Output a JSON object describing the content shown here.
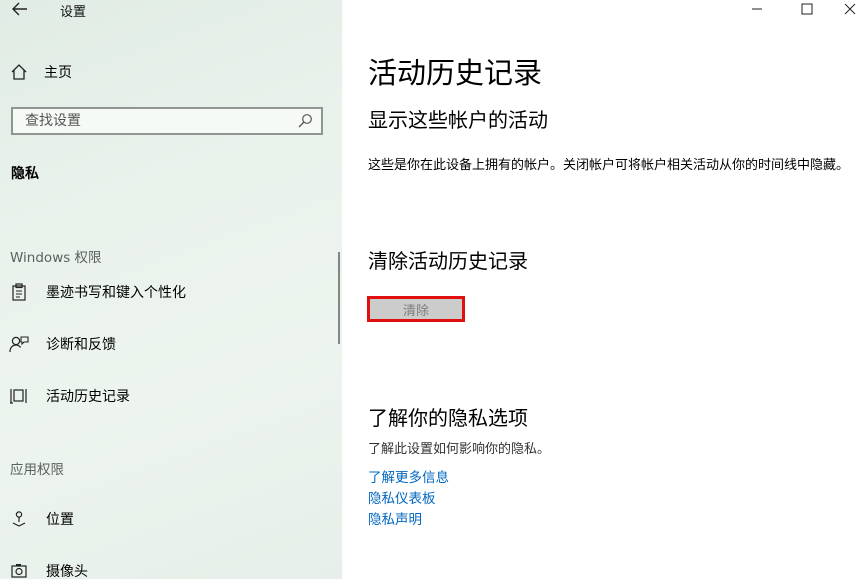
{
  "window": {
    "title": "设置",
    "controls": {
      "minimize": "—",
      "maximize": "☐",
      "close": "✕"
    }
  },
  "sidebar": {
    "home_label": "主页",
    "search": {
      "placeholder": "查找设置",
      "value": ""
    },
    "category": "隐私",
    "sections": [
      {
        "title": "Windows 权限",
        "items": [
          {
            "label": "墨迹书写和键入个性化",
            "icon": "clipboard-icon"
          },
          {
            "label": "诊断和反馈",
            "icon": "feedback-icon"
          },
          {
            "label": "活动历史记录",
            "icon": "timeline-icon"
          }
        ]
      },
      {
        "title": "应用权限",
        "items": [
          {
            "label": "位置",
            "icon": "location-icon"
          },
          {
            "label": "摄像头",
            "icon": "camera-icon"
          }
        ]
      }
    ]
  },
  "main": {
    "title": "活动历史记录",
    "show_accounts_heading": "显示这些帐户的活动",
    "show_accounts_desc": "这些是你在此设备上拥有的帐户。关闭帐户可将帐户相关活动从你的时间线中隐藏。",
    "clear_heading": "清除活动历史记录",
    "clear_button": "清除",
    "privacy_heading": "了解你的隐私选项",
    "privacy_desc": "了解此设置如何影响你的隐私。",
    "links": [
      "了解更多信息",
      "隐私仪表板",
      "隐私声明"
    ]
  },
  "colors": {
    "accent_link": "#0067c0",
    "highlight_border": "#e01010",
    "button_disabled_bg": "#cccccc"
  }
}
